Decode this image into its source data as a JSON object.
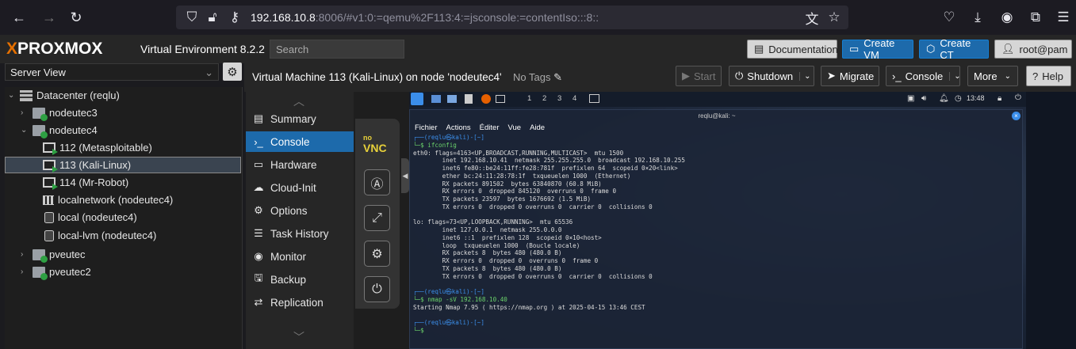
{
  "browser": {
    "url_host": "192.168.10.8",
    "url_rest": ":8006/#v1:0:=qemu%2F113:4:=jsconsole:=contentIso:::8::",
    "icons": [
      "back-icon",
      "forward-icon",
      "reload-icon",
      "shield-icon",
      "lock-icon",
      "key-icon",
      "translate-icon",
      "star-icon",
      "pocket-icon",
      "download-icon",
      "account-icon",
      "extensions-icon",
      "menu-icon"
    ]
  },
  "header": {
    "logo_x": "X",
    "logo_text": "PROXMOX",
    "version": "Virtual Environment 8.2.2",
    "search_placeholder": "Search",
    "documentation": "Documentation",
    "create_vm": "Create VM",
    "create_ct": "Create CT",
    "user": "root@pam"
  },
  "sidebar": {
    "view": "Server View",
    "tree": [
      {
        "label": "Datacenter (reqlu)",
        "type": "datacenter"
      },
      {
        "label": "nodeutec3",
        "type": "node"
      },
      {
        "label": "nodeutec4",
        "type": "node"
      },
      {
        "label": "112 (Metasploitable)",
        "type": "vm"
      },
      {
        "label": "113 (Kali-Linux)",
        "type": "vm",
        "selected": true
      },
      {
        "label": "114 (Mr-Robot)",
        "type": "vm"
      },
      {
        "label": "localnetwork (nodeutec4)",
        "type": "network"
      },
      {
        "label": "local (nodeutec4)",
        "type": "storage"
      },
      {
        "label": "local-lvm (nodeutec4)",
        "type": "storage"
      },
      {
        "label": "pveutec",
        "type": "node"
      },
      {
        "label": "pveutec2",
        "type": "node"
      }
    ]
  },
  "content": {
    "title": "Virtual Machine 113 (Kali-Linux) on node 'nodeutec4'",
    "tags": "No Tags",
    "actions": {
      "start": "Start",
      "shutdown": "Shutdown",
      "migrate": "Migrate",
      "console": "Console",
      "more": "More",
      "help": "Help"
    },
    "menu": [
      {
        "label": "Summary",
        "icon": "summary-icon"
      },
      {
        "label": "Console",
        "icon": "console-icon",
        "active": true
      },
      {
        "label": "Hardware",
        "icon": "hardware-icon"
      },
      {
        "label": "Cloud-Init",
        "icon": "cloud-icon"
      },
      {
        "label": "Options",
        "icon": "options-icon"
      },
      {
        "label": "Task History",
        "icon": "task-history-icon"
      },
      {
        "label": "Monitor",
        "icon": "monitor-icon"
      },
      {
        "label": "Backup",
        "icon": "backup-icon"
      },
      {
        "label": "Replication",
        "icon": "replication-icon"
      }
    ]
  },
  "vnc": {
    "logo_top": "no",
    "logo_bottom": "VNC"
  },
  "kali": {
    "workspaces": [
      "1",
      "2",
      "3",
      "4"
    ],
    "time": "13:48",
    "term_title": "reqlu@kali: ~",
    "term_menu": [
      "Fichier",
      "Actions",
      "Éditer",
      "Vue",
      "Aide"
    ],
    "prompt": "┌──(reqlu㉿kali)-[~]",
    "cmd1": "└─$ ifconfig",
    "out1": "eth0: flags=4163<UP,BROADCAST,RUNNING,MULTICAST>  mtu 1500\n        inet 192.168.10.41  netmask 255.255.255.0  broadcast 192.168.10.255\n        inet6 fe80::be24:11ff:fe28:781f  prefixlen 64  scopeid 0×20<link>\n        ether bc:24:11:28:78:1f  txqueuelen 1000  (Ethernet)\n        RX packets 891502  bytes 63840870 (60.8 MiB)\n        RX errors 0  dropped 845120  overruns 0  frame 0\n        TX packets 23597  bytes 1676692 (1.5 MiB)\n        TX errors 0  dropped 0 overruns 0  carrier 0  collisions 0\n\nlo: flags=73<UP,LOOPBACK,RUNNING>  mtu 65536\n        inet 127.0.0.1  netmask 255.0.0.0\n        inet6 ::1  prefixlen 128  scopeid 0×10<host>\n        loop  txqueuelen 1000  (Boucle locale)\n        RX packets 8  bytes 480 (480.0 B)\n        RX errors 0  dropped 0  overruns 0  frame 0\n        TX packets 8  bytes 480 (480.0 B)\n        TX errors 0  dropped 0 overruns 0  carrier 0  collisions 0\n",
    "prompt2": "┌──(reqlu㉿kali)-[~]",
    "cmd2": "└─$ nmap -sV 192.168.10.40",
    "out2": "Starting Nmap 7.95 ( https://nmap.org ) at 2025-04-15 13:46 CEST",
    "prompt3": "┌──(reqlu㉿kali)-[~]",
    "cmd3": "└─$ "
  }
}
